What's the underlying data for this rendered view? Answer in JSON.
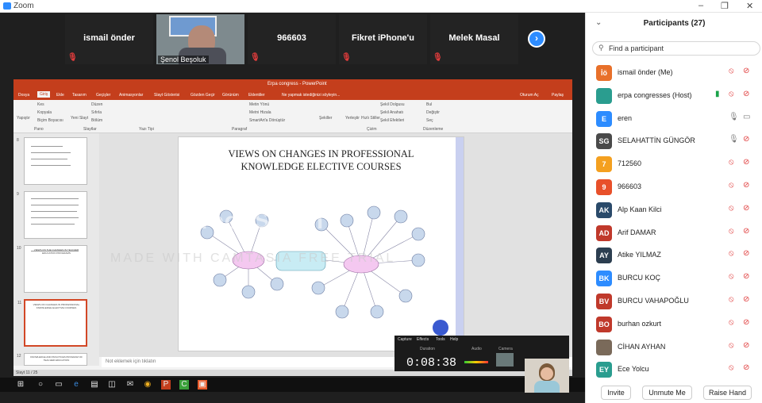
{
  "app": {
    "title": "Zoom"
  },
  "gallery": {
    "tiles": [
      "ismail önder",
      "Şenol Beşoluk",
      "966603",
      "Fikret iPhone'u",
      "Melek Masal"
    ]
  },
  "ppt": {
    "window_title": "Erpa congress - PowerPoint",
    "menu": [
      "Dosya",
      "Giriş",
      "Ekle",
      "Tasarım",
      "Geçişler",
      "Animasyonlar",
      "Slayt Gösterisi",
      "Gözden Geçir",
      "Görünüm",
      "Eklentiler"
    ],
    "tell_me": "Ne yapmak istediğinizi söyleyin...",
    "account": "Oturum Aç",
    "share": "Paylaş",
    "ribbon": [
      "Yapıştır",
      "Kes",
      "Kopyala",
      "Biçim Boyacısı",
      "Pano",
      "Yeni Slayt",
      "Düzen",
      "Sıfırla",
      "Bölüm",
      "Slaytlar",
      "Yazı Tipi",
      "Paragraf",
      "Metin Yönü",
      "Metni Hizala",
      "SmartArt'a Dönüştür",
      "Şekiller",
      "Yerleştir",
      "Hızlı Stiller",
      "Şekil Dolgusu",
      "Şekil Anahatı",
      "Şekil Efektleri",
      "Çizim",
      "Bul",
      "Değiştir",
      "Seç",
      "Düzenleme"
    ],
    "thumbs": [
      "8",
      "9",
      "10",
      "11",
      "12"
    ],
    "thumb_titles": [
      "VIEWS ON THE CHANGES IN TEACHER EDUCATION PROGRAMS",
      "VIEWS ON CHANGES IN PROFESSIONAL KNOWLEDGE ELECTIVE COURSES",
      "KNOWLEDGE AND PRACTICES PROGRAM OF TEACHER EDUCATION"
    ],
    "slide_title": [
      "VIEWS ON CHANGES IN PROFESSIONAL",
      "KNOWLEDGE ELECTIVE COURSES"
    ],
    "watermark": "TechSmith",
    "watermark2": "MADE WITH CAMTASIA FREE TRIAL",
    "notes": "Not eklemek için tıklatın",
    "status": "Slayt 11 / 25"
  },
  "recorder": {
    "menu": [
      "Capture",
      "Effects",
      "Tools",
      "Help"
    ],
    "duration_label": "Duration",
    "audio_label": "Audio",
    "camera_label": "Camera",
    "duration": "0:08:38"
  },
  "participants": {
    "header": "Participants (27)",
    "search_placeholder": "Find a participant",
    "list": [
      {
        "initials": "İö",
        "name": "ismail önder (Me)",
        "color": "#e8702a",
        "cam": "off",
        "mic": "off"
      },
      {
        "initials": "",
        "name": "erpa congresses (Host)",
        "color": "#2a9d8f",
        "cam": "off",
        "mic": "off"
      },
      {
        "initials": "E",
        "name": "eren",
        "color": "#2d8cff",
        "cam": "on",
        "mic": "on"
      },
      {
        "initials": "SG",
        "name": "SELAHATTİN GÜNGÖR",
        "color": "#4a4a4a",
        "cam": "off",
        "mic": "on"
      },
      {
        "initials": "7",
        "name": "712560",
        "color": "#f4a020",
        "cam": "off",
        "mic": "off"
      },
      {
        "initials": "9",
        "name": "966603",
        "color": "#e8502a",
        "cam": "off",
        "mic": "off"
      },
      {
        "initials": "AK",
        "name": "Alp Kaan Kilci",
        "color": "#2a4a6a",
        "cam": "off",
        "mic": "off"
      },
      {
        "initials": "AD",
        "name": "Arif DAMAR",
        "color": "#c0392b",
        "cam": "off",
        "mic": "off"
      },
      {
        "initials": "AY",
        "name": "Atike YILMAZ",
        "color": "#2c3e50",
        "cam": "off",
        "mic": "off"
      },
      {
        "initials": "BK",
        "name": "BURCU KOÇ",
        "color": "#2d8cff",
        "cam": "off",
        "mic": "off"
      },
      {
        "initials": "BV",
        "name": "BURCU VAHAPOĞLU",
        "color": "#c0392b",
        "cam": "off",
        "mic": "off"
      },
      {
        "initials": "BO",
        "name": "burhan ozkurt",
        "color": "#c0392b",
        "cam": "off",
        "mic": "off"
      },
      {
        "initials": "",
        "name": "CİHAN AYHAN",
        "color": "#7a6a5a",
        "cam": "off",
        "mic": "off"
      },
      {
        "initials": "EY",
        "name": "Ece Yolcu",
        "color": "#2a9d8f",
        "cam": "off",
        "mic": "off"
      }
    ],
    "buttons": {
      "invite": "Invite",
      "unmute": "Unmute Me",
      "raise": "Raise Hand"
    }
  },
  "icons": [
    "zoom-logo-icon",
    "minimize-icon",
    "maximize-icon",
    "close-icon",
    "muted-mic-icon",
    "next-page-icon",
    "search-icon",
    "mic-icon",
    "muted-video-icon",
    "video-icon",
    "share-screen-icon",
    "windows-start-icon"
  ],
  "colors": {
    "ppt_accent": "#c43e1c",
    "zoom_blue": "#2d8cff",
    "muted_red": "#e03c3c"
  }
}
